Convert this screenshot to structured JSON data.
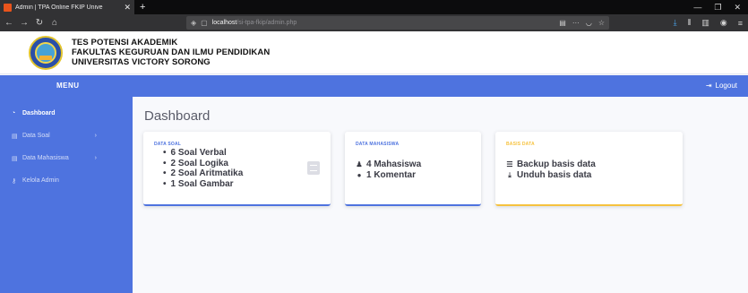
{
  "browser": {
    "tab_title": "Admin | TPA Online FKIP Unive",
    "url_host": "localhost",
    "url_path": "/si-tpa-fkip/admin.php"
  },
  "site": {
    "line1": "TES POTENSI AKADEMIK",
    "line2": "FAKULTAS KEGURUAN DAN ILMU PENDIDIKAN",
    "line3": "UNIVERSITAS VICTORY SORONG"
  },
  "topbar": {
    "menu_label": "MENU",
    "logout_label": "Logout"
  },
  "sidebar": {
    "items": [
      {
        "label": "Dashboard",
        "icon": "tachometer-icon"
      },
      {
        "label": "Data Soal",
        "icon": "list-icon"
      },
      {
        "label": "Data Mahasiswa",
        "icon": "list-icon"
      },
      {
        "label": "Kelola Admin",
        "icon": "key-icon"
      }
    ]
  },
  "main": {
    "title": "Dashboard",
    "cards": {
      "soal": {
        "heading": "DATA SOAL",
        "items": [
          "6 Soal Verbal",
          "2 Soal Logika",
          "2 Soal Aritmatika",
          "1 Soal Gambar"
        ]
      },
      "mahasiswa": {
        "heading": "DATA MAHASISWA",
        "rows": [
          "4 Mahasiswa",
          "1 Komentar"
        ]
      },
      "basis": {
        "heading": "BASIS DATA",
        "rows": [
          "Backup basis data",
          "Unduh basis data"
        ]
      }
    }
  },
  "colors": {
    "primary": "#4e73df",
    "warning": "#f6c23e",
    "text": "#3a3b45"
  }
}
